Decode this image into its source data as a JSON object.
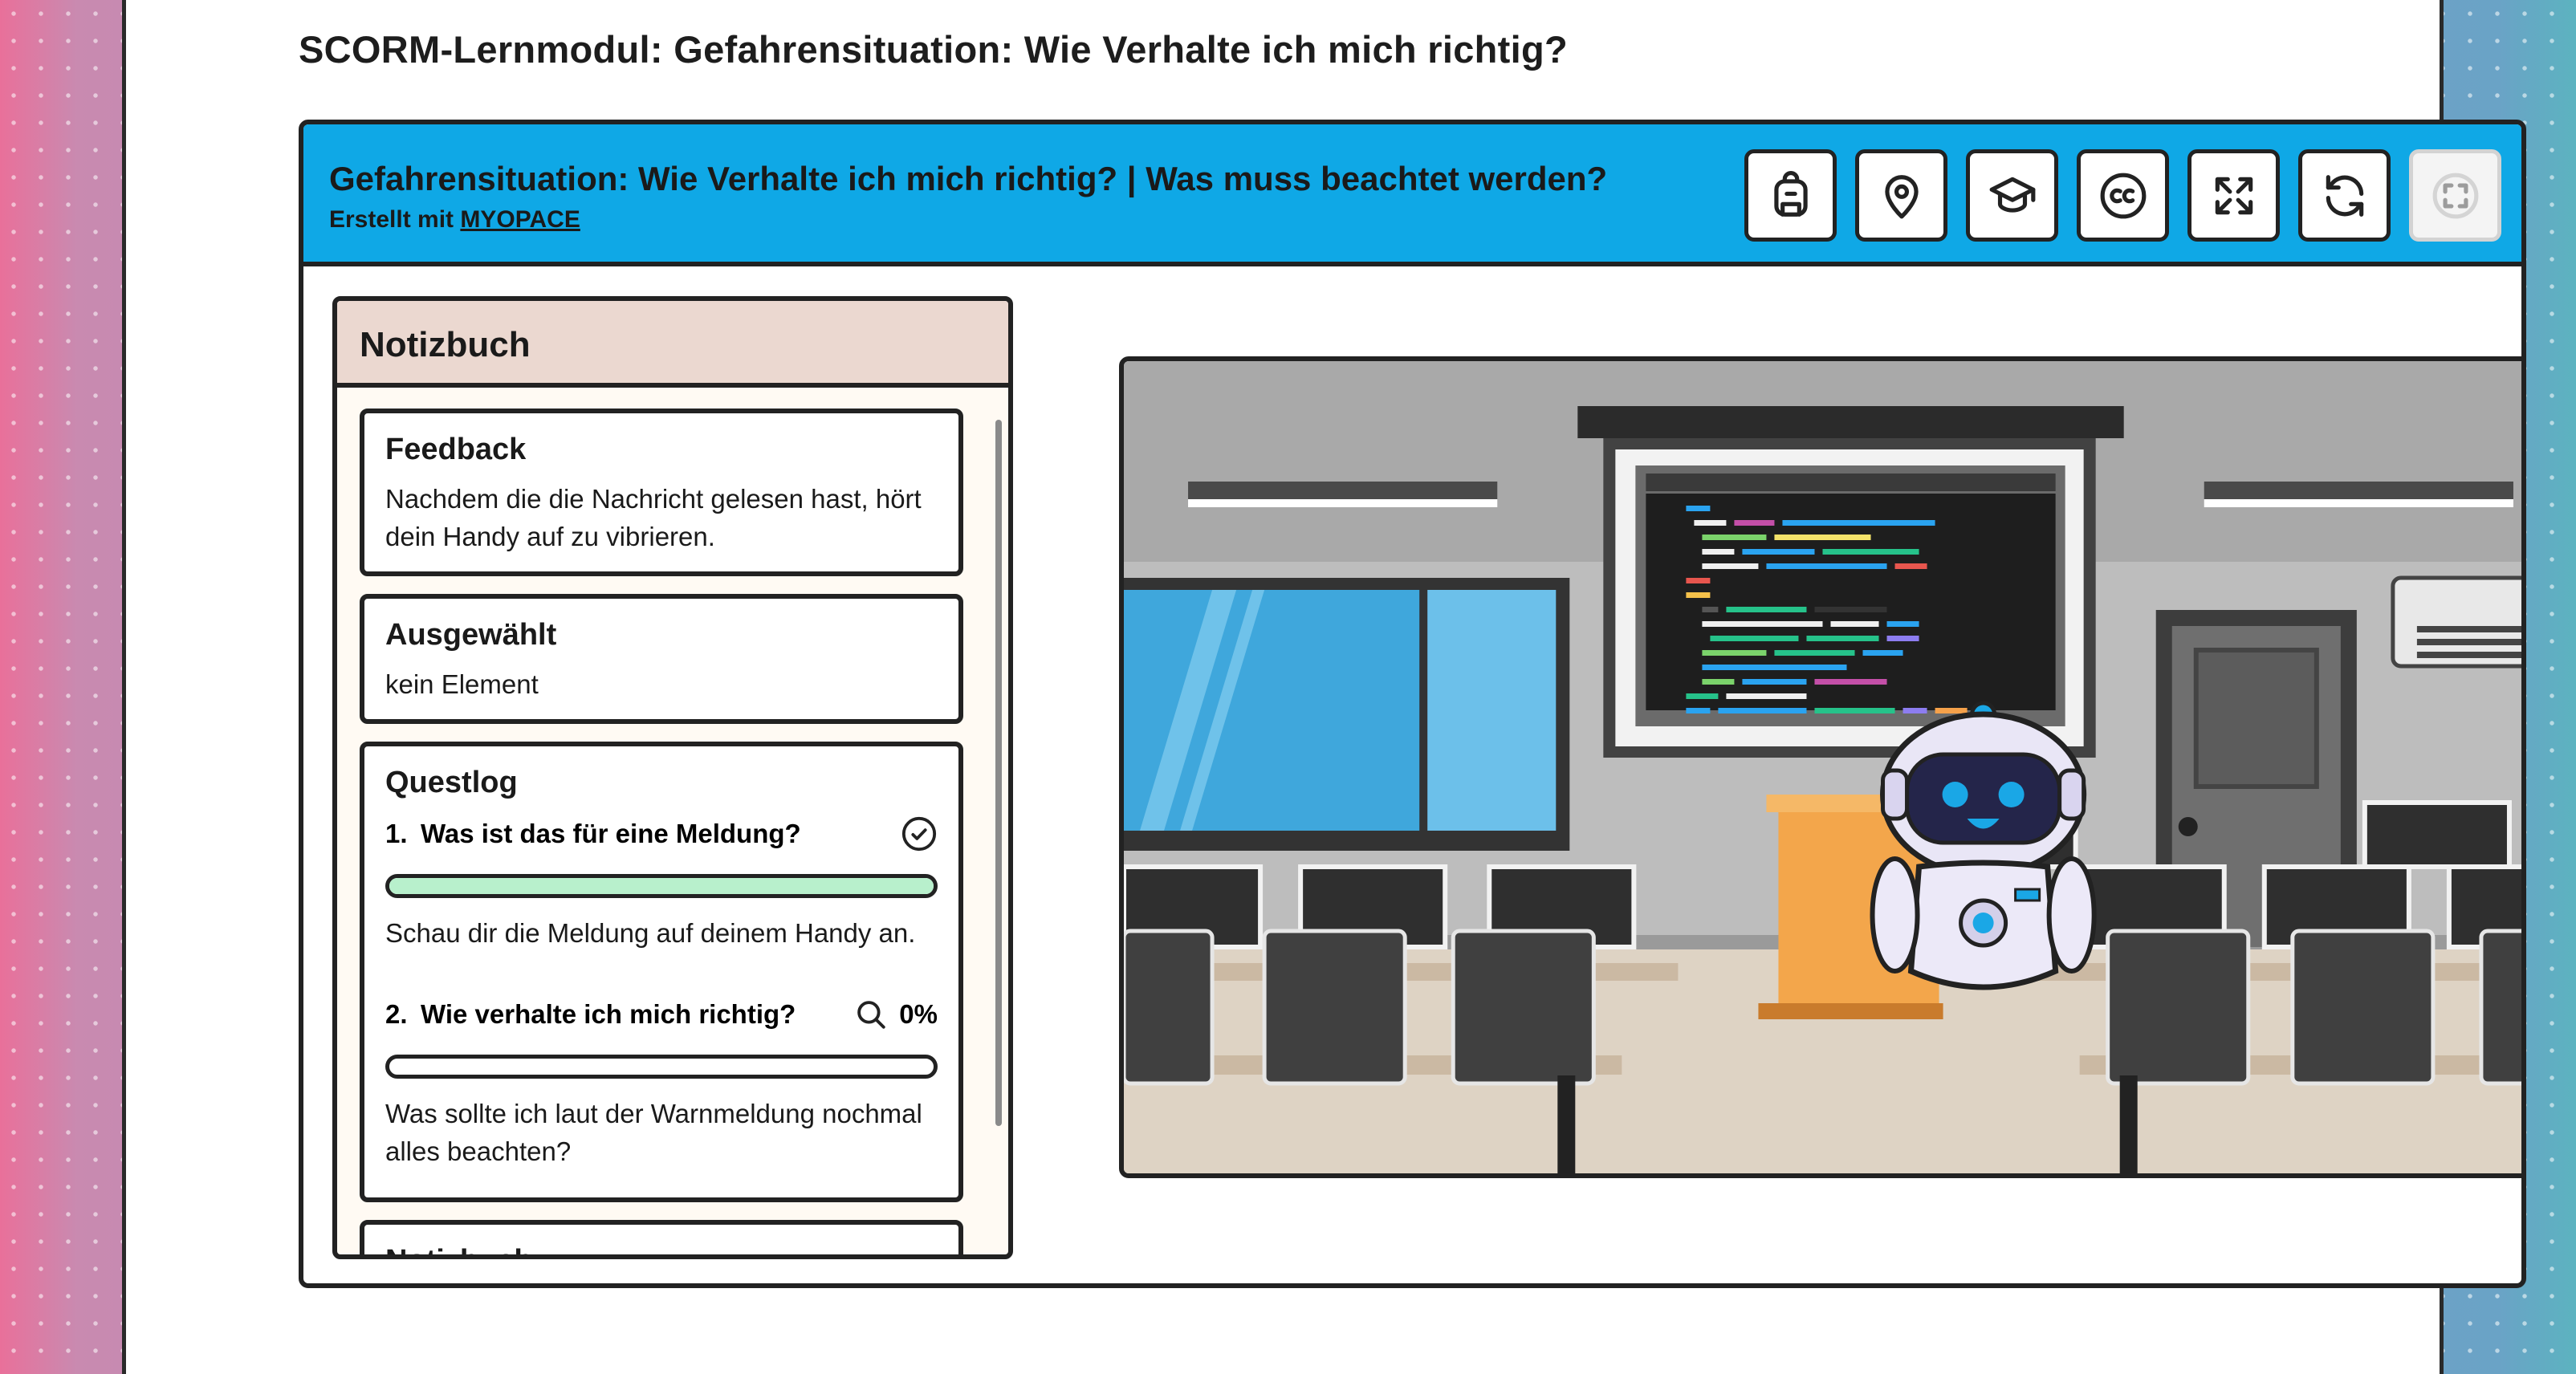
{
  "page": {
    "title": "SCORM-Lernmodul: Gefahrensituation: Wie Verhalte ich mich richtig?"
  },
  "module": {
    "title": "Gefahrensituation: Wie Verhalte ich mich richtig? | Was muss beachtet werden?",
    "credit_prefix": "Erstellt mit",
    "credit_link": "MYOPACE"
  },
  "toolbar": {
    "buttons": [
      {
        "name": "inventory-button",
        "icon": "backpack-icon"
      },
      {
        "name": "map-button",
        "icon": "map-pin-icon"
      },
      {
        "name": "learning-button",
        "icon": "graduation-cap-icon"
      },
      {
        "name": "subtitles-button",
        "icon": "closed-captions-icon"
      },
      {
        "name": "fullscreen-button",
        "icon": "expand-icon"
      },
      {
        "name": "restart-button",
        "icon": "refresh-icon"
      },
      {
        "name": "focus-button",
        "icon": "focus-frame-icon",
        "disabled": true
      }
    ]
  },
  "notebook": {
    "title": "Notizbuch",
    "feedback": {
      "heading": "Feedback",
      "text": "Nachdem die die Nachricht gelesen hast, hört dein Handy auf zu vibrieren."
    },
    "selected": {
      "heading": "Ausgewählt",
      "text": "kein Element"
    },
    "questlog": {
      "heading": "Questlog",
      "quests": [
        {
          "number": "1.",
          "title": "Was ist das für eine Meldung?",
          "status_icon": "check-circle-icon",
          "progress": 1.0,
          "description": "Schau dir die Meldung auf deinem Handy an."
        },
        {
          "number": "2.",
          "title": "Wie verhalte ich mich richtig?",
          "status_icon": "search-icon",
          "percent": "0%",
          "progress": 0.0,
          "description": "Was sollte ich laut der Warnmeldung nochmal alles beachten?"
        }
      ]
    },
    "next_card_heading": "Notizbuch"
  },
  "colors": {
    "topbar": "#0fa8e6",
    "notebook_header": "#ebd8d0",
    "progress_fill": "#b8f0cc",
    "border": "#222222"
  }
}
